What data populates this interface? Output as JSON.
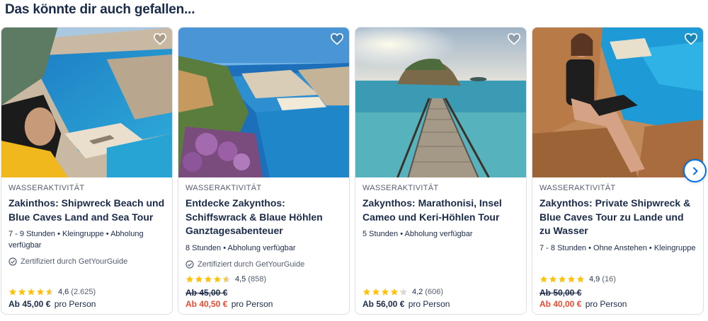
{
  "section": {
    "title": "Das könnte dir auch gefallen..."
  },
  "colors": {
    "accent": "#0071eb",
    "sale": "#eb4a2f",
    "star": "#ffc107",
    "text": "#1a2b49"
  },
  "cards": [
    {
      "category": "WASSERAKTIVITÄT",
      "title": "Zakinthos: Shipwreck Beach und Blue Caves Land and Sea Tour",
      "meta": "7 - 9 Stunden • Kleingruppe • Abholung verfügbar",
      "certified": "Zertifiziert durch GetYourGuide",
      "rating": 4.6,
      "rating_text": "4,6",
      "reviews": "(2.625)",
      "old_price": "",
      "price": "Ab 45,00 €",
      "per": "pro Person",
      "image_icon": "shipwreck-bay-woman-photo"
    },
    {
      "category": "WASSERAKTIVITÄT",
      "title": "Entdecke Zakynthos: Schiffswrack & Blaue Höhlen Ganztagesabenteuer",
      "meta": "8 Stunden • Abholung verfügbar",
      "certified": "Zertifiziert durch GetYourGuide",
      "rating": 4.5,
      "rating_text": "4,5",
      "reviews": "(858)",
      "old_price": "Ab 45,00 €",
      "price": "Ab 40,50 €",
      "per": "pro Person",
      "image_icon": "shipwreck-bay-flowers-photo"
    },
    {
      "category": "WASSERAKTIVITÄT",
      "title": "Zakynthos: Marathonisi, Insel Cameo und Keri-Höhlen Tour",
      "meta": "5 Stunden • Abholung verfügbar",
      "certified": "",
      "rating": 4.2,
      "rating_text": "4,2",
      "reviews": "(606)",
      "old_price": "",
      "price": "Ab 56,00 €",
      "per": "pro Person",
      "image_icon": "cameo-island-bridge-photo"
    },
    {
      "category": "WASSERAKTIVITÄT",
      "title": "Zakynthos: Private Shipwreck & Blue Caves Tour zu Lande und zu Wasser",
      "meta": "7 - 8 Stunden • Ohne Anstehen • Kleingruppe",
      "certified": "",
      "rating": 4.9,
      "rating_text": "4,9",
      "reviews": "(16)",
      "old_price": "Ab 50,00 €",
      "price": "Ab 40,00 €",
      "per": "pro Person",
      "image_icon": "woman-on-cliff-photo"
    }
  ],
  "controls": {
    "wishlist_icon": "heart-outline-icon",
    "next_icon": "chevron-right-icon"
  }
}
